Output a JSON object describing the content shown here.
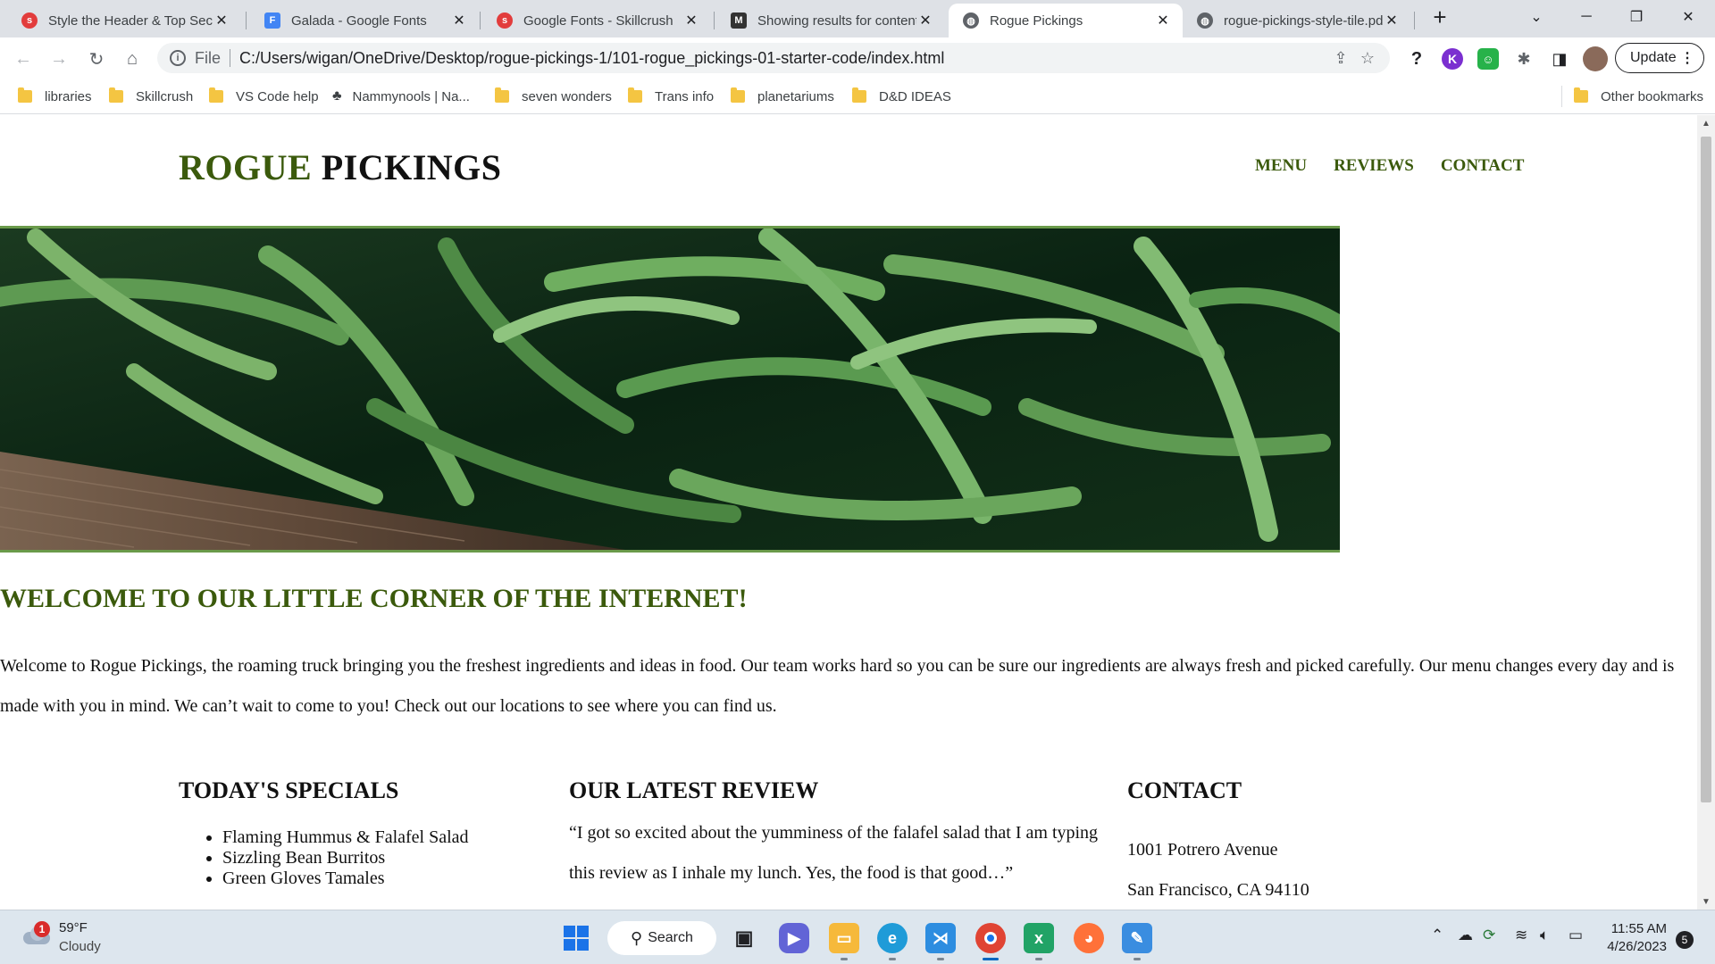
{
  "browser": {
    "tabs": [
      {
        "title": "Style the Header & Top Sec",
        "favicon": "skillcrush-icon",
        "color": "#e23c3c"
      },
      {
        "title": "Galada - Google Fonts",
        "favicon": "google-fonts-icon",
        "color": "#4285f4"
      },
      {
        "title": "Google Fonts - Skillcrush",
        "favicon": "skillcrush-icon",
        "color": "#e23c3c"
      },
      {
        "title": "Showing results for content",
        "favicon": "mdn-icon",
        "color": "#333333"
      },
      {
        "title": "Rogue Pickings",
        "favicon": "globe-icon",
        "color": "#5f6368",
        "active": true
      },
      {
        "title": "rogue-pickings-style-tile.pd",
        "favicon": "globe-icon",
        "color": "#5f6368"
      }
    ],
    "omnibox": {
      "scheme_label": "File",
      "url": "C:/Users/wigan/OneDrive/Desktop/rogue-pickings-1/101-rogue_pickings-01-starter-code/index.html"
    },
    "update_label": "Update",
    "bookmarks": [
      {
        "label": "libraries",
        "icon": "folder-icon"
      },
      {
        "label": "Skillcrush",
        "icon": "folder-icon"
      },
      {
        "label": "VS Code help",
        "icon": "folder-icon"
      },
      {
        "label": "Nammynools | Na...",
        "icon": "nammynools-icon"
      },
      {
        "label": "seven wonders",
        "icon": "folder-icon"
      },
      {
        "label": "Trans info",
        "icon": "folder-icon"
      },
      {
        "label": "planetariums",
        "icon": "folder-icon"
      },
      {
        "label": "D&D IDEAS",
        "icon": "folder-icon"
      }
    ],
    "other_bookmarks": "Other bookmarks"
  },
  "page": {
    "brand_first": "ROGUE",
    "brand_second": "PICKINGS",
    "nav": [
      "MENU",
      "REVIEWS",
      "CONTACT"
    ],
    "welcome": "WELCOME TO OUR LITTLE CORNER OF THE INTERNET!",
    "intro": "Welcome to Rogue Pickings, the roaming truck bringing you the freshest ingredients and ideas in food. Our team works hard so you can be sure our ingredients are always fresh and picked carefully. Our menu changes every day and is made with you in mind. We can’t wait to come to you! Check out our locations to see where you can find us.",
    "specials_heading": "TODAY'S SPECIALS",
    "specials": [
      "Flaming Hummus & Falafel Salad",
      "Sizzling Bean Burritos",
      "Green Gloves Tamales"
    ],
    "review_heading": "OUR LATEST REVIEW",
    "review": "“I got so excited about the yumminess of the falafel salad that I am typing this review as I inhale my lunch. Yes, the food is that good…”",
    "contact_heading": "CONTACT",
    "contact_lines": [
      "1001 Potrero Avenue",
      "San Francisco, CA 94110"
    ],
    "colors": {
      "brand_green": "#3b5a0c",
      "hero_border": "#6a9a4a"
    }
  },
  "taskbar": {
    "weather_temp": "59°F",
    "weather_desc": "Cloudy",
    "weather_badge": "1",
    "search_label": "Search",
    "time": "11:55 AM",
    "date": "4/26/2023",
    "notification_count": "5",
    "apps": [
      "windows-start-icon",
      "task-view-icon",
      "teams-chat-icon",
      "file-explorer-icon",
      "edge-icon",
      "vscode-icon",
      "chrome-icon",
      "excel-icon",
      "firefox-icon",
      "paint-icon"
    ]
  }
}
